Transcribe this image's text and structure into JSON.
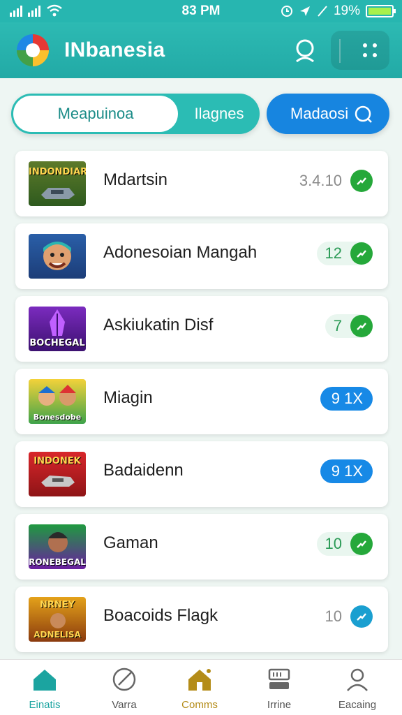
{
  "status_bar": {
    "time": "83 PM",
    "battery": "19%"
  },
  "header": {
    "title": "INbanesia"
  },
  "tabs": {
    "active": "Meapuinoa",
    "second": "Ilagnes",
    "search": "Madaosi"
  },
  "games": [
    {
      "name": "Mdartsin",
      "thumb_caption": "INDONDIAR",
      "badge_text": "3.4.10",
      "badge_style": "plain",
      "icon": "check-icon"
    },
    {
      "name": "Adonesoian Mangah",
      "thumb_caption": "",
      "badge_text": "12",
      "badge_style": "light",
      "icon": "check-icon"
    },
    {
      "name": "Askiukatin Disf",
      "thumb_caption": "BOCHEGAL",
      "badge_text": "7",
      "badge_style": "light",
      "icon": "check-icon"
    },
    {
      "name": "Miagin",
      "thumb_caption": "Bonesdobe",
      "badge_text": "9 1X",
      "badge_style": "blue",
      "icon": ""
    },
    {
      "name": "Badaidenn",
      "thumb_caption": "INDONEK",
      "badge_text": "9 1X",
      "badge_style": "blue",
      "icon": ""
    },
    {
      "name": "Gaman",
      "thumb_caption": "RONEBEGAL",
      "badge_text": "10",
      "badge_style": "light",
      "icon": "check-icon"
    },
    {
      "name": "Boacoids Flagk",
      "thumb_caption": "NRNEY",
      "thumb_caption_2": "ADNELISA",
      "badge_text": "10",
      "badge_style": "plain",
      "icon": "check-icon"
    }
  ],
  "bottom_nav": [
    {
      "label": "Einatis",
      "icon": "home-icon"
    },
    {
      "label": "Varra",
      "icon": "compass-icon"
    },
    {
      "label": "Comms",
      "icon": "house-icon"
    },
    {
      "label": "Irrine",
      "icon": "server-icon"
    },
    {
      "label": "Eacaing",
      "icon": "profile-icon"
    }
  ],
  "colors": {
    "header": "#27b6b0",
    "active_tab_text": "#1b8c88",
    "search_pill": "#1785e0",
    "check": "#25a83a",
    "nav_active": "#1ba4a0"
  }
}
